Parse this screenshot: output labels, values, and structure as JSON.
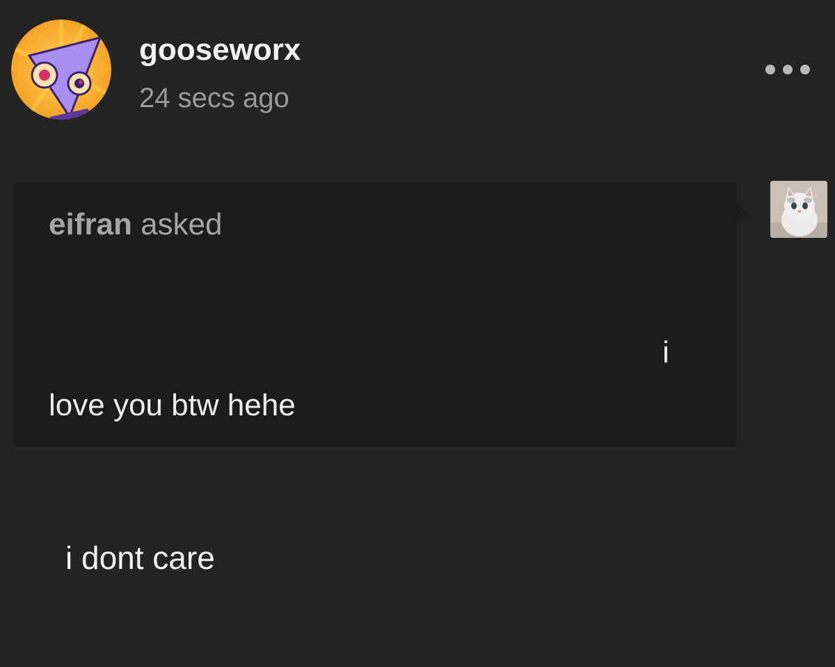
{
  "post": {
    "username": "gooseworx",
    "timestamp": "24 secs ago",
    "avatar_icon": "cartoon-triangle-avatar-icon",
    "menu_icon": "more-options-icon"
  },
  "ask": {
    "asker": "eifran",
    "asked_label": "asked",
    "question_line1": "i",
    "question_line2": "love you btw hehe",
    "asker_avatar_icon": "kitten-avatar-icon"
  },
  "answer": {
    "text": "i dont care"
  },
  "colors": {
    "background": "#232323",
    "ask_box": "#1c1c1c",
    "text_primary": "#f2f2f2",
    "text_secondary": "#9a9a9a",
    "avatar_bg": "#f6a623",
    "avatar_shape": "#a98ef0"
  }
}
